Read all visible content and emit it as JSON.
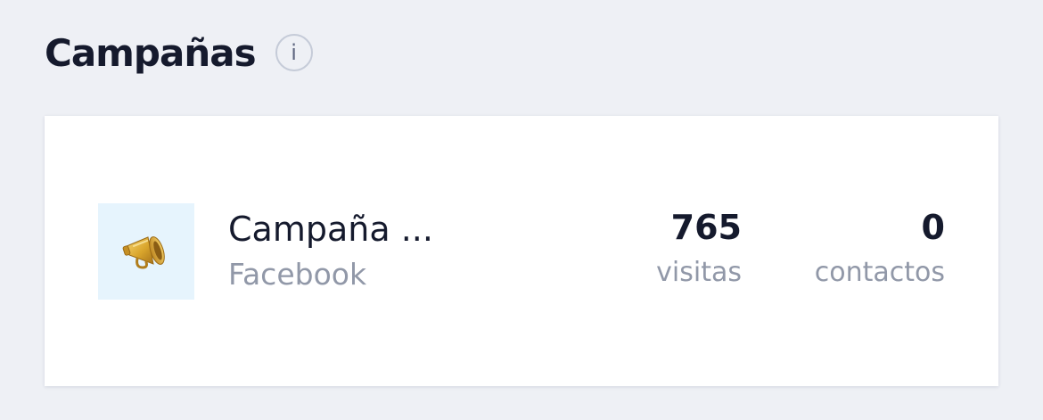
{
  "header": {
    "title": "Campañas",
    "info_glyph": "i"
  },
  "campaigns": [
    {
      "icon": "megaphone-icon",
      "name": "Campaña ...",
      "source": "Facebook",
      "visits_value": "765",
      "visits_label": "visitas",
      "contacts_value": "0",
      "contacts_label": "contactos"
    }
  ],
  "colors": {
    "background": "#eef0f5",
    "card": "#ffffff",
    "thumb_background": "#e6f4fd",
    "text_primary": "#151a2d",
    "text_secondary": "#9198a8"
  }
}
